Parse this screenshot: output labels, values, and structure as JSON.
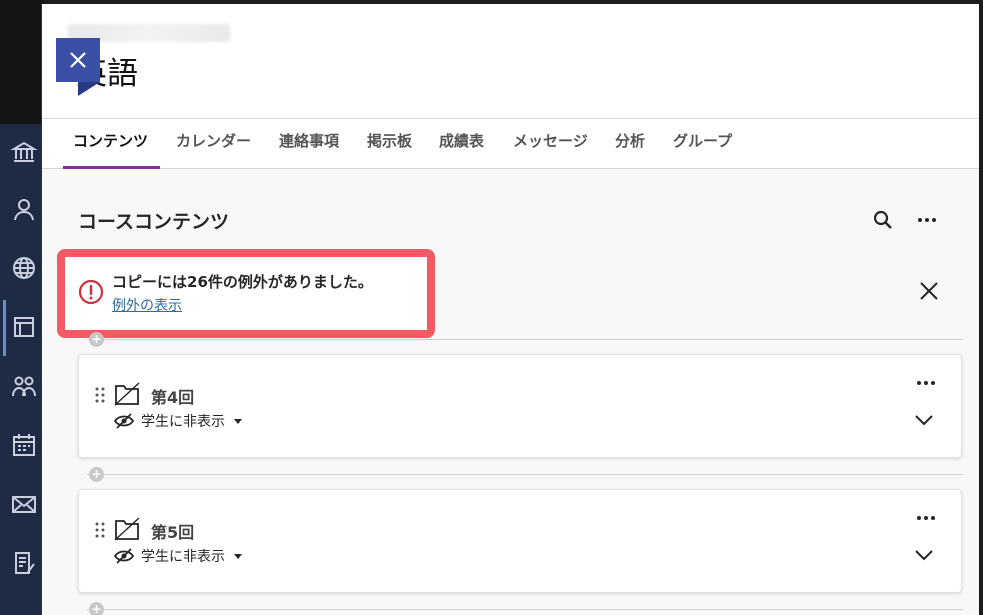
{
  "course": {
    "title": "英語"
  },
  "tabs": [
    {
      "label": "コンテンツ",
      "active": true
    },
    {
      "label": "カレンダー"
    },
    {
      "label": "連絡事項"
    },
    {
      "label": "掲示板"
    },
    {
      "label": "成績表"
    },
    {
      "label": "メッセージ"
    },
    {
      "label": "分析"
    },
    {
      "label": "グループ"
    }
  ],
  "content": {
    "section_title": "コースコンテンツ",
    "alert": {
      "message": "コピーには26件の例外がありました。",
      "link": "例外の表示"
    },
    "items": [
      {
        "title": "第4回",
        "visibility": "学生に非表示"
      },
      {
        "title": "第5回",
        "visibility": "学生に非表示"
      }
    ]
  },
  "colors": {
    "accent": "#8a2ba0",
    "close_button": "#3b4fa6",
    "alert_highlight": "#f25b63",
    "alert_icon": "#c8313d",
    "link": "#2d6aa8",
    "nav_bg": "#1f2a44"
  },
  "icons": {
    "nav": [
      "institution-icon",
      "profile-icon",
      "globe-icon",
      "courses-icon",
      "groups-icon",
      "calendar-icon",
      "mail-icon",
      "grades-icon"
    ],
    "item": [
      "drag-handle-icon",
      "folder-icon",
      "hidden-eye-icon",
      "chevron-down-icon",
      "more-icon"
    ]
  }
}
